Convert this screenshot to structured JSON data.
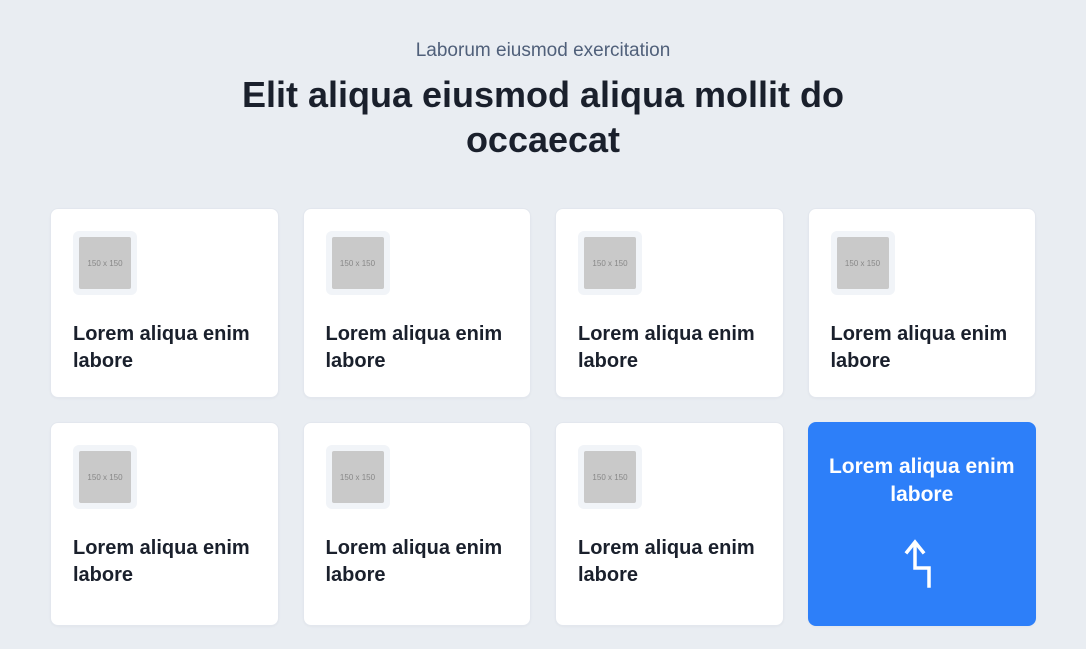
{
  "overline": "Laborum eiusmod exercitation",
  "heading": "Elit aliqua eiusmod aliqua mollit do occaecat",
  "thumb_label": "150 x 150",
  "cards": [
    {
      "title": "Lorem aliqua enim labore"
    },
    {
      "title": "Lorem aliqua enim labore"
    },
    {
      "title": "Lorem aliqua enim labore"
    },
    {
      "title": "Lorem aliqua enim labore"
    },
    {
      "title": "Lorem aliqua enim labore"
    },
    {
      "title": "Lorem aliqua enim labore"
    },
    {
      "title": "Lorem aliqua enim labore"
    }
  ],
  "cta": {
    "title": "Lorem aliqua enim labore"
  }
}
